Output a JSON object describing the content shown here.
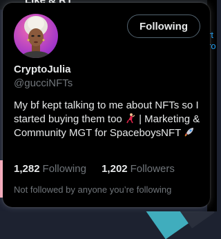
{
  "background": {
    "top_text": "Like & RT",
    "right_fragments": [
      "rt",
      "ro"
    ]
  },
  "profile": {
    "display_name": "CryptoJulia",
    "handle": "@gucciNFTs",
    "follow_button_label": "Following",
    "bio_parts": {
      "line1": "My bf kept talking to me about NFTs so I started buying them too",
      "line2": "| Marketing & Community MGT for SpaceboysNFT"
    },
    "bio_emojis": [
      "dancer-emoji",
      "rocket-emoji"
    ],
    "following_count": "1,282",
    "following_label": "Following",
    "followers_count": "1,202",
    "followers_label": "Followers",
    "not_followed_text": "Not followed by anyone you’re following"
  },
  "colors": {
    "card_bg": "#000000",
    "primary_text": "#e7e9ea",
    "secondary_text": "#71767b",
    "link_blue": "#1d9bf0"
  }
}
